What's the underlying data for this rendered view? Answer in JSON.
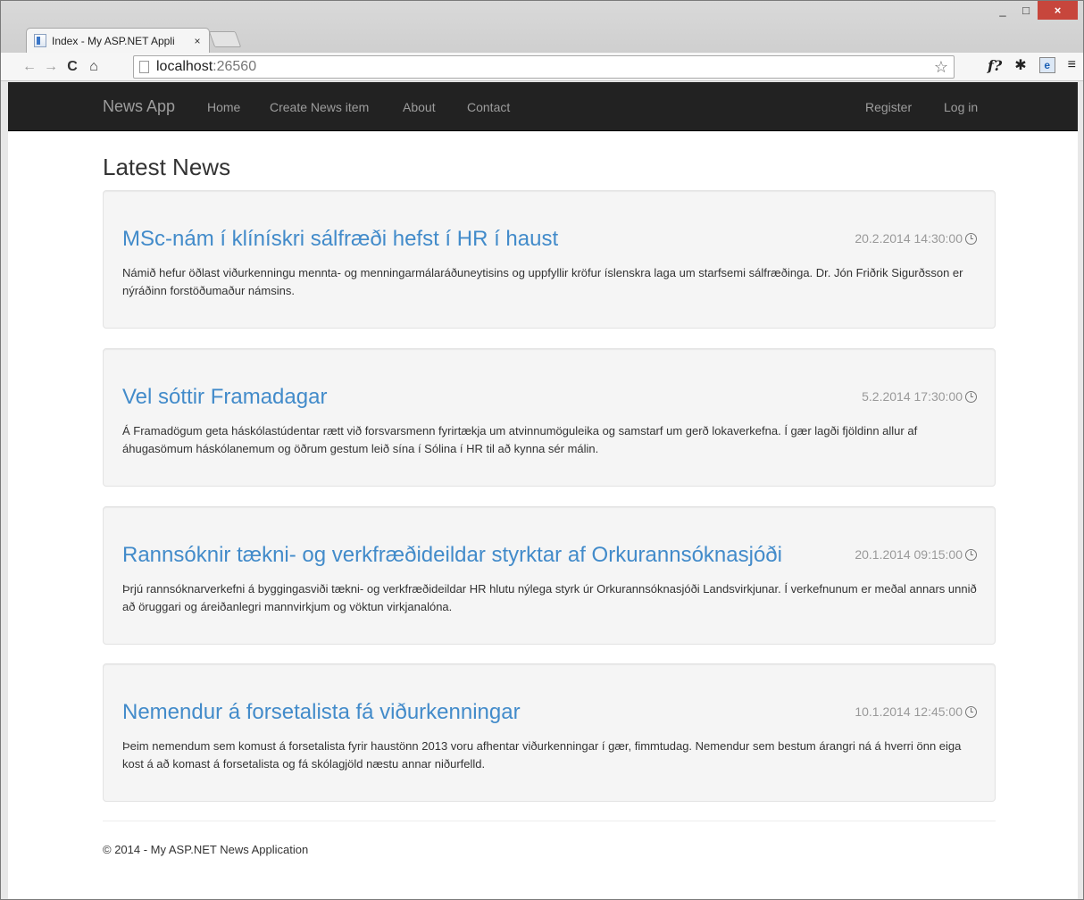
{
  "browser": {
    "tab_title": "Index - My ASP.NET Appli",
    "tab_close": "×",
    "url_host": "localhost",
    "url_port": ":26560",
    "win_min": "_",
    "win_max": "□",
    "win_close": "×"
  },
  "navbar": {
    "brand": "News App",
    "links": [
      "Home",
      "Create News item",
      "About",
      "Contact"
    ],
    "right_links": [
      "Register",
      "Log in"
    ]
  },
  "main": {
    "title": "Latest News",
    "articles": [
      {
        "title": "MSc-nám í klínískri sálfræði hefst í HR í haust",
        "date": "20.2.2014 14:30:00",
        "body": "Námið hefur öðlast viðurkenningu mennta- og menningarmálaráðuneytisins og uppfyllir kröfur íslenskra laga um starfsemi sálfræðinga. Dr. Jón Friðrik Sigurðsson er nýráðinn forstöðumaður námsins."
      },
      {
        "title": "Vel sóttir Framadagar",
        "date": "5.2.2014 17:30:00",
        "body": "Á Framadögum geta háskólastúdentar rætt við forsvarsmenn fyrirtækja um atvinnumöguleika og samstarf um gerð lokaverkefna. Í gær lagði fjöldinn allur af áhugasömum háskólanemum og öðrum gestum leið sína í Sólina í HR til að kynna sér málin."
      },
      {
        "title": "Rannsóknir tækni- og verkfræðideildar styrktar af Orkurannsóknasjóði",
        "date": "20.1.2014 09:15:00",
        "body": "Þrjú rannsóknarverkefni á byggingasviði tækni- og verkfræðideildar HR hlutu nýlega styrk úr Orkurannsóknasjóði Landsvirkjunar. Í verkefnunum er meðal annars unnið að öruggari og áreiðanlegri mannvirkjum og vöktun virkjanalóna."
      },
      {
        "title": "Nemendur á forsetalista fá viðurkenningar",
        "date": "10.1.2014 12:45:00",
        "body": "Þeim nemendum sem komust á forsetalista fyrir haustönn 2013 voru afhentar viðurkenningar í gær, fimmtudag. Nemendur sem bestum árangri ná á hverri önn eiga kost á að komast á forsetalista og fá skólagjöld næstu annar niðurfelld."
      }
    ]
  },
  "footer": {
    "text": "© 2014 - My ASP.NET News Application"
  }
}
